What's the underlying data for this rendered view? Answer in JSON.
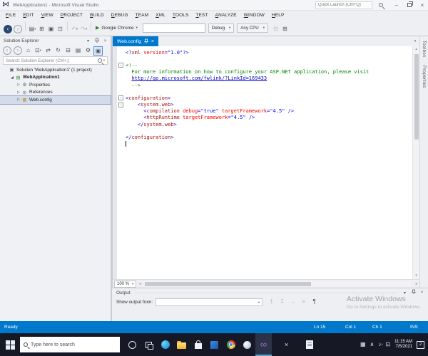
{
  "icons": {
    "chevron_down": "▾",
    "close": "×",
    "minimize": "–",
    "up_arrow": "▴",
    "down_arrow": "▾",
    "left_arrow": "◂",
    "right_arrow": "▸",
    "run": "▶"
  },
  "window": {
    "title": "WebApplication1 - Microsoft Visual Studio",
    "quick_launch_placeholder": "Quick Launch (Ctrl+Q)",
    "logo_glyph": "⋈"
  },
  "menu": {
    "items": [
      "FILE",
      "EDIT",
      "VIEW",
      "PROJECT",
      "BUILD",
      "DEBUG",
      "TEAM",
      "XML",
      "TOOLS",
      "TEST",
      "ANALYZE",
      "WINDOW",
      "HELP"
    ]
  },
  "toolbar": {
    "left_icons": [
      {
        "name": "nav-back-icon",
        "glyph": "‹",
        "circle": "dark"
      },
      {
        "name": "nav-forward-icon",
        "glyph": "›",
        "circle": "light"
      },
      {
        "sep": true
      },
      {
        "name": "new-file-icon",
        "glyph": "▤",
        "dd": true
      },
      {
        "name": "add-item-icon",
        "glyph": "⊞"
      },
      {
        "name": "save-icon",
        "glyph": "▣"
      },
      {
        "name": "save-all-icon",
        "glyph": "⊡"
      },
      {
        "sep": true
      },
      {
        "name": "undo-icon",
        "glyph": "↶",
        "muted": true,
        "dd": true
      },
      {
        "name": "redo-icon",
        "glyph": "↷",
        "muted": true,
        "dd": true
      },
      {
        "sep": true
      }
    ],
    "run_label": "Google Chrome",
    "config_label": "Debug",
    "platform_label": "Any CPU",
    "right_icons": [
      {
        "name": "attach-icon",
        "glyph": "⊟",
        "muted": true
      },
      {
        "name": "find-in-files-icon",
        "glyph": "⊞"
      }
    ]
  },
  "solution_explorer": {
    "title": "Solution Explorer",
    "toolbar": [
      {
        "name": "se-back-icon",
        "glyph": "‹",
        "circle": "light"
      },
      {
        "name": "se-forward-icon",
        "glyph": "›",
        "circle": "light"
      },
      {
        "name": "home-icon",
        "glyph": "⌂"
      },
      {
        "name": "scope-icon",
        "glyph": "⊡",
        "dd": true
      },
      {
        "name": "sync-icon",
        "glyph": "⇄"
      },
      {
        "name": "refresh-icon",
        "glyph": "↻"
      },
      {
        "name": "collapse-all-icon",
        "glyph": "⊟"
      },
      {
        "name": "show-all-files-icon",
        "glyph": "▤"
      },
      {
        "name": "properties-gear-icon",
        "glyph": "⚙"
      },
      {
        "name": "preview-selected-icon",
        "glyph": "▣",
        "active": true
      }
    ],
    "search_placeholder": "Search Solution Explorer (Ctrl+;)",
    "node_glyphs": {
      "solution": "▣",
      "project": "▤",
      "properties": "⚙",
      "references": "⊞",
      "config": "▦"
    },
    "tree": [
      {
        "label": "Solution 'WebApplication1' (1 project)",
        "icon": "solution",
        "indent": 0,
        "arrow": "",
        "bold": false,
        "selected": false
      },
      {
        "label": "WebApplication1",
        "icon": "project",
        "indent": 1,
        "arrow": "expanded",
        "bold": true,
        "selected": false
      },
      {
        "label": "Properties",
        "icon": "properties",
        "indent": 2,
        "arrow": "collapsed",
        "bold": false,
        "selected": false
      },
      {
        "label": "References",
        "icon": "references",
        "indent": 2,
        "arrow": "collapsed",
        "bold": false,
        "selected": false
      },
      {
        "label": "Web.config",
        "icon": "config",
        "indent": 2,
        "arrow": "collapsed",
        "bold": false,
        "selected": true
      }
    ]
  },
  "editor": {
    "tab_label": "Web.config",
    "zoom_level": "100 %",
    "code": {
      "lines": [
        {
          "tokens": [
            [
              "<?",
              "d"
            ],
            [
              "xml",
              "e"
            ],
            [
              " ",
              "p"
            ],
            [
              "version",
              "a"
            ],
            [
              "=",
              "d"
            ],
            [
              "\"1.0\"",
              "v"
            ],
            [
              "?>",
              "d"
            ]
          ]
        },
        {
          "tokens": []
        },
        {
          "fold": true,
          "tokens": [
            [
              "<!--",
              "c"
            ]
          ]
        },
        {
          "tokens": [
            [
              "  For more information on how to configure your ASP.NET application, please visit",
              "c"
            ]
          ]
        },
        {
          "tokens": [
            [
              "  ",
              "p"
            ],
            [
              "http://go.microsoft.com/fwlink/?LinkId=169433",
              "l"
            ]
          ]
        },
        {
          "tokens": [
            [
              "  -->",
              "c"
            ]
          ]
        },
        {
          "tokens": []
        },
        {
          "fold": true,
          "tokens": [
            [
              "<",
              "d"
            ],
            [
              "configuration",
              "e"
            ],
            [
              ">",
              "d"
            ]
          ]
        },
        {
          "fold": true,
          "tokens": [
            [
              "    ",
              "p"
            ],
            [
              "<",
              "d"
            ],
            [
              "system.web",
              "e"
            ],
            [
              ">",
              "d"
            ]
          ]
        },
        {
          "tokens": [
            [
              "      ",
              "p"
            ],
            [
              "<",
              "d"
            ],
            [
              "compilation",
              "e"
            ],
            [
              " ",
              "p"
            ],
            [
              "debug",
              "a"
            ],
            [
              "=",
              "d"
            ],
            [
              "\"true\"",
              "v"
            ],
            [
              " ",
              "p"
            ],
            [
              "targetFramework",
              "a"
            ],
            [
              "=",
              "d"
            ],
            [
              "\"4.5\"",
              "v"
            ],
            [
              " />",
              "d"
            ]
          ]
        },
        {
          "tokens": [
            [
              "      ",
              "p"
            ],
            [
              "<",
              "d"
            ],
            [
              "httpRuntime",
              "e"
            ],
            [
              " ",
              "p"
            ],
            [
              "targetFramework",
              "a"
            ],
            [
              "=",
              "d"
            ],
            [
              "\"4.5\"",
              "v"
            ],
            [
              " />",
              "d"
            ]
          ]
        },
        {
          "tokens": [
            [
              "    ",
              "p"
            ],
            [
              "</",
              "d"
            ],
            [
              "system.web",
              "e"
            ],
            [
              ">",
              "d"
            ]
          ]
        },
        {
          "tokens": []
        },
        {
          "tokens": [
            [
              "</",
              "d"
            ],
            [
              "configuration",
              "e"
            ],
            [
              ">",
              "d"
            ]
          ]
        },
        {
          "cursor": true,
          "tokens": []
        }
      ]
    }
  },
  "right_tabs": [
    {
      "label": "Toolbox"
    },
    {
      "label": "Properties"
    }
  ],
  "output": {
    "title": "Output",
    "show_output_from_label": "Show output from:",
    "toolbar_icons": [
      {
        "name": "prev-message-icon",
        "glyph": "↥",
        "muted": true
      },
      {
        "name": "next-message-icon",
        "glyph": "↧",
        "muted": true
      },
      {
        "name": "go-to-message-icon",
        "glyph": "→",
        "muted": true
      },
      {
        "name": "clear-all-icon",
        "glyph": "≡",
        "muted": true
      },
      {
        "name": "word-wrap-icon",
        "glyph": "¶"
      }
    ],
    "watermark": {
      "line1": "Activate Windows",
      "line2": "Go to Settings to activate Windows."
    }
  },
  "status_bar": {
    "ready": "Ready",
    "ln": "Ln 15",
    "col": "Col 1",
    "ch": "Ch 1",
    "mode": "INS"
  },
  "taskbar": {
    "search_placeholder": "Type here to search",
    "icons": [
      {
        "name": "cortana-icon"
      },
      {
        "name": "task-view-icon"
      },
      {
        "name": "edge-icon"
      },
      {
        "name": "file-explorer-icon"
      },
      {
        "name": "store-icon"
      },
      {
        "name": "mail-icon"
      },
      {
        "name": "chrome-icon"
      },
      {
        "name": "photos-icon"
      },
      {
        "name": "visual-studio-icon",
        "glyph": "∞",
        "active": true
      },
      {
        "name": "app-utility-icon",
        "glyph": "×",
        "gap": true
      },
      {
        "name": "app-editor-icon",
        "gap": true
      }
    ],
    "tray_icons": [
      {
        "name": "tray-app-icon",
        "glyph": "▦"
      },
      {
        "name": "chevron-up-icon",
        "glyph": "∧"
      },
      {
        "name": "volume-muted-icon",
        "glyph": "♪",
        "cls": "vmute"
      },
      {
        "name": "network-icon",
        "glyph": "⊡"
      }
    ],
    "tray": {
      "time": "11:15 AM",
      "date": "7/5/2021",
      "badge": "2"
    }
  }
}
